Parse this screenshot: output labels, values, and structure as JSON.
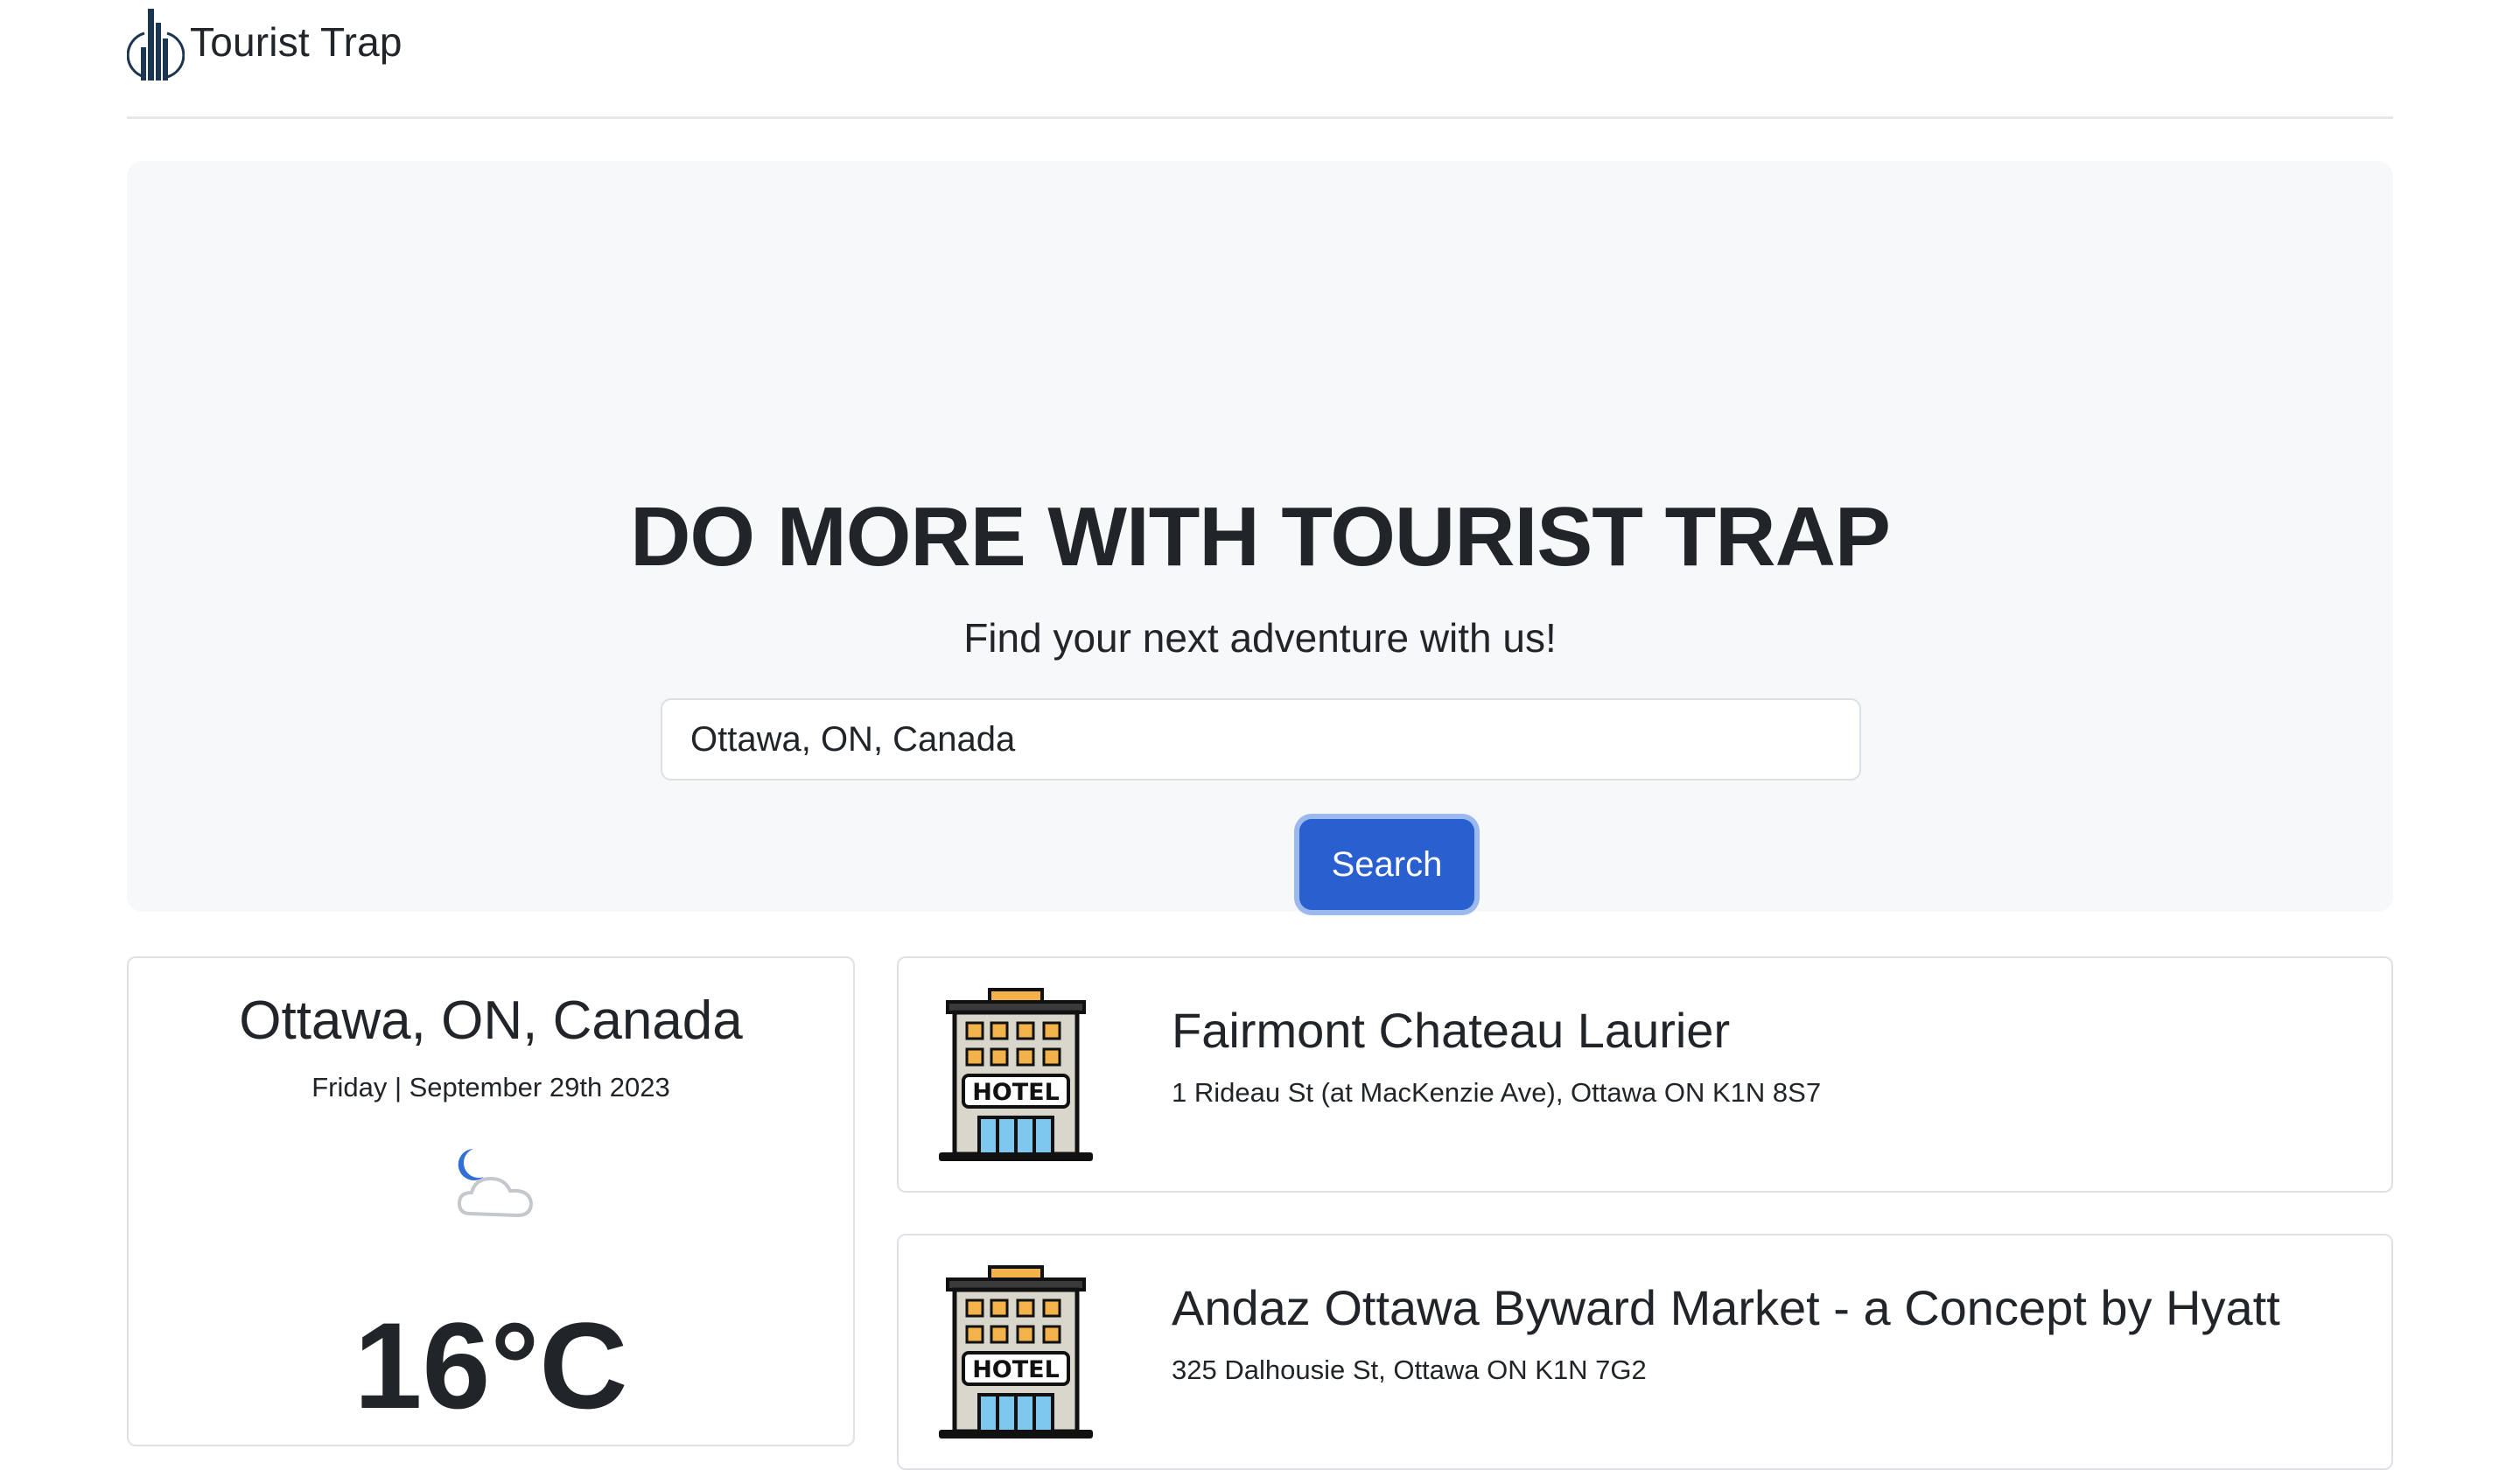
{
  "header": {
    "brand_name": "Tourist Trap",
    "logo_icon": "city-skyline-icon"
  },
  "hero": {
    "title": "DO MORE WITH TOURIST TRAP",
    "subtitle": "Find your next adventure with us!",
    "search_value": "Ottawa, ON, Canada",
    "search_button_label": "Search"
  },
  "weather": {
    "city": "Ottawa, ON, Canada",
    "date": "Friday | September 29th 2023",
    "icon": "moon-cloud-icon",
    "temperature": "16°C"
  },
  "hotels": [
    {
      "name": "Fairmont Chateau Laurier",
      "address": "1 Rideau St (at MacKenzie Ave), Ottawa ON K1N 8S7",
      "icon_label": "HOTEL"
    },
    {
      "name": "Andaz Ottawa Byward Market - a Concept by Hyatt",
      "address": "325 Dalhousie St, Ottawa ON K1N 7G2",
      "icon_label": "HOTEL"
    }
  ],
  "colors": {
    "primary": "#2a5fd0",
    "hero_bg": "#f7f8f9",
    "text": "#212529",
    "border": "#dee2e6"
  }
}
